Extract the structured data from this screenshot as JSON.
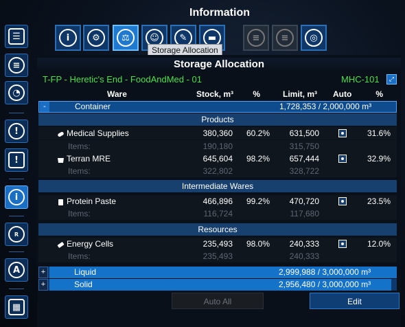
{
  "window": {
    "title": "Information",
    "panel_title": "Storage Allocation"
  },
  "tooltip": "Storage Allocation",
  "station": {
    "name": "T-FP - Heretic's End - FoodAndMed - 01",
    "code": "MHC-101"
  },
  "columns": {
    "ware": "Ware",
    "stock": "Stock, m³",
    "stock_pct": "%",
    "limit": "Limit, m³",
    "auto": "Auto",
    "limit_pct": "%"
  },
  "container": {
    "toggle": "-",
    "label": "Container",
    "usage": "1,728,353 / 2,000,000 m³",
    "fill": 0.864
  },
  "sections": {
    "products": "Products",
    "intermediate": "Intermediate Wares",
    "resources": "Resources"
  },
  "wares": [
    {
      "name": "Medical Supplies",
      "icon": "pill-icon",
      "stock": "380,360",
      "stock_pct": "60.2%",
      "limit": "631,500",
      "limit_pct": "31.6%",
      "items_label": "Items:",
      "items_stock": "190,180",
      "items_limit": "315,750"
    },
    {
      "name": "Terran MRE",
      "icon": "ration-icon",
      "stock": "645,604",
      "stock_pct": "98.2%",
      "limit": "657,444",
      "limit_pct": "32.9%",
      "items_label": "Items:",
      "items_stock": "322,802",
      "items_limit": "328,722"
    },
    {
      "name": "Protein Paste",
      "icon": "jar-icon",
      "stock": "466,896",
      "stock_pct": "99.2%",
      "limit": "470,720",
      "limit_pct": "23.5%",
      "items_label": "Items:",
      "items_stock": "116,724",
      "items_limit": "117,680"
    },
    {
      "name": "Energy Cells",
      "icon": "battery-icon",
      "stock": "235,493",
      "stock_pct": "98.0%",
      "limit": "240,333",
      "limit_pct": "12.0%",
      "items_label": "Items:",
      "items_stock": "235,493",
      "items_limit": "240,333"
    }
  ],
  "storage": [
    {
      "toggle": "+",
      "label": "Liquid",
      "usage": "2,999,988 / 3,000,000 m³",
      "fill": 0.99999
    },
    {
      "toggle": "+",
      "label": "Solid",
      "usage": "2,956,480 / 3,000,000 m³",
      "fill": 0.985
    }
  ],
  "buttons": {
    "auto_all": "Auto All",
    "edit": "Edit"
  },
  "fit_icon": "expand-icon",
  "colors": {
    "accent": "#1a6fc4",
    "station_green": "#4ce04c",
    "section_bg": "#18406f"
  }
}
